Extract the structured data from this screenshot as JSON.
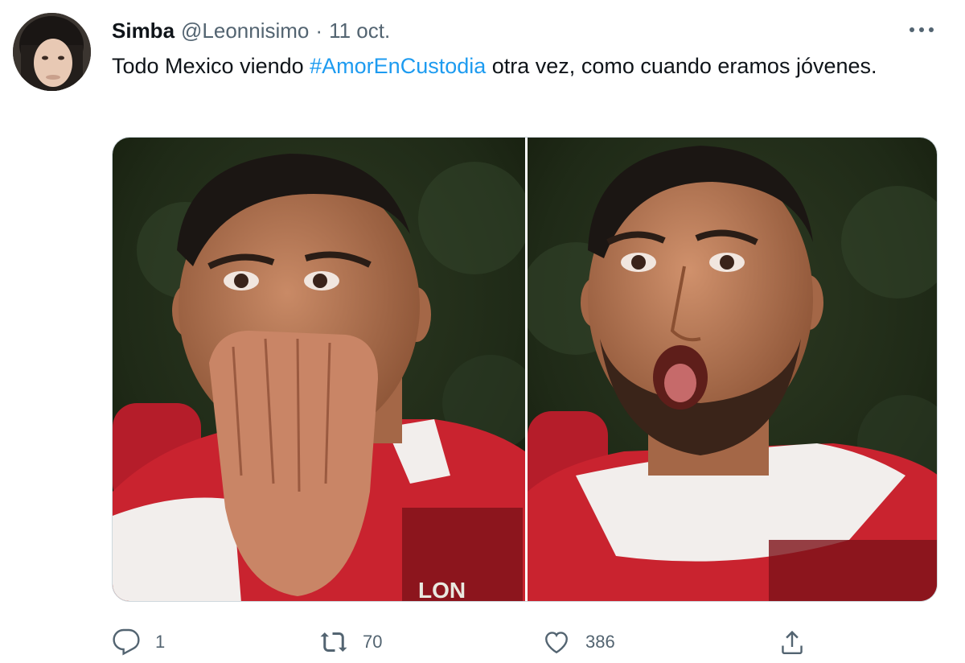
{
  "tweet": {
    "author": {
      "display_name": "Simba",
      "handle": "@Leonnisimo",
      "avatar_icon": "profile-avatar"
    },
    "separator": "·",
    "date": "11 oct.",
    "text_before": "Todo Mexico viendo ",
    "hashtag": "#AmorEnCustodia",
    "text_after": " otra vez, como cuando eramos jóvenes.",
    "media": [
      {
        "description_icon": "photo-man-covering-mouth-surprised"
      },
      {
        "description_icon": "photo-man-mouth-open-shocked",
        "jersey_text": "LON"
      }
    ],
    "actions": {
      "reply_count": "1",
      "retweet_count": "70",
      "like_count": "386"
    }
  },
  "colors": {
    "hashtag": "#1d9bf0",
    "secondary_text": "#536471",
    "primary_text": "#0f1419"
  }
}
